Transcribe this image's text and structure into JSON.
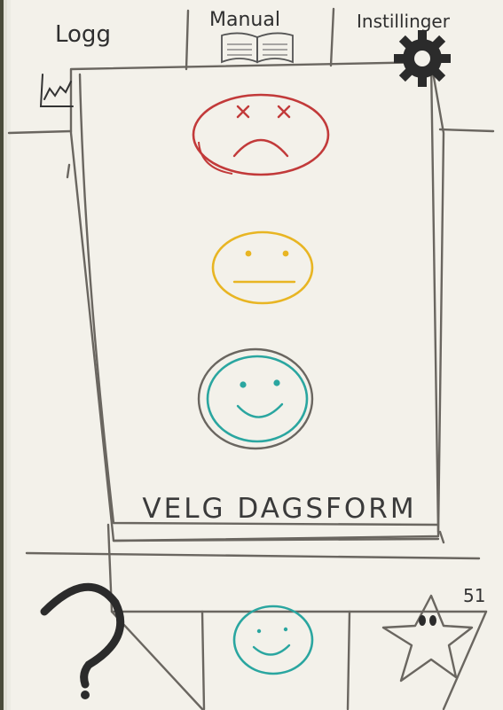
{
  "tabs": [
    {
      "label": "Logg",
      "icon": "chart-icon"
    },
    {
      "label": "Manual",
      "icon": "book-icon"
    },
    {
      "label": "Instillinger",
      "icon": "gear-icon"
    }
  ],
  "mood_prompt": "VELG DAGSFORM",
  "moods": [
    {
      "name": "sad",
      "color": "#c23a3a"
    },
    {
      "name": "neutral",
      "color": "#e8b523"
    },
    {
      "name": "happy",
      "color": "#2aa6a0"
    }
  ],
  "bottom_nav": [
    {
      "icon": "question-mark-icon"
    },
    {
      "icon": "happy-face-icon",
      "color": "#2aa6a0"
    },
    {
      "icon": "star-icon"
    }
  ],
  "page_number": "51"
}
